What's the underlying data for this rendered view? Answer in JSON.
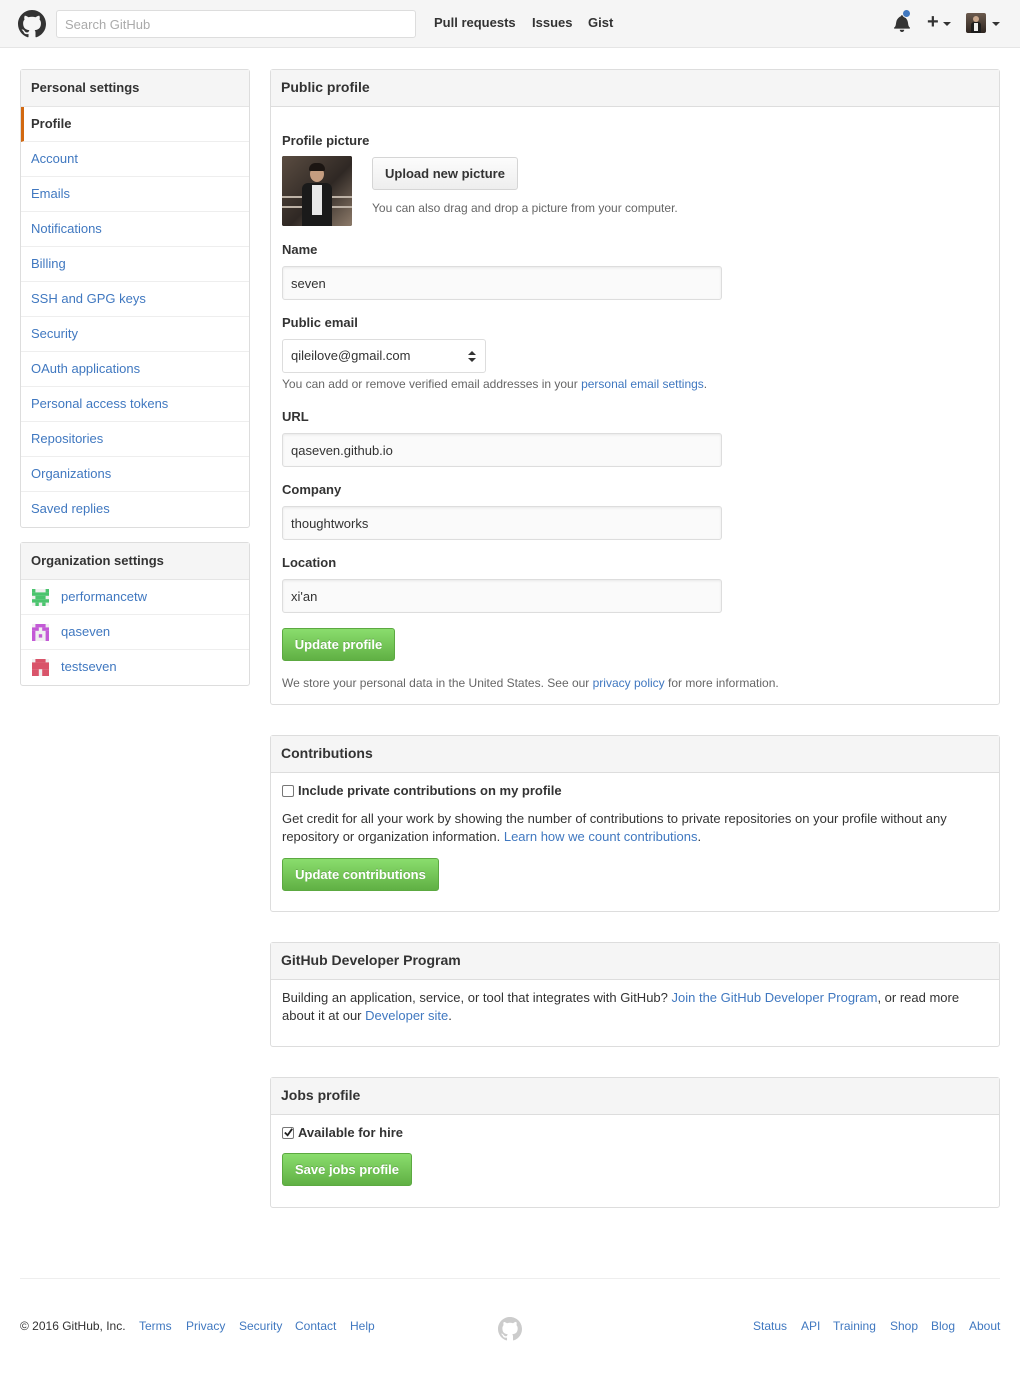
{
  "header": {
    "search_placeholder": "Search GitHub",
    "nav": [
      "Pull requests",
      "Issues",
      "Gist"
    ],
    "notification_indicator": "unread",
    "accent_color": "#4078c0"
  },
  "sidebar": {
    "personal_heading": "Personal settings",
    "items": [
      {
        "label": "Profile",
        "selected": true
      },
      {
        "label": "Account"
      },
      {
        "label": "Emails"
      },
      {
        "label": "Notifications"
      },
      {
        "label": "Billing"
      },
      {
        "label": "SSH and GPG keys"
      },
      {
        "label": "Security"
      },
      {
        "label": "OAuth applications"
      },
      {
        "label": "Personal access tokens"
      },
      {
        "label": "Repositories"
      },
      {
        "label": "Organizations"
      },
      {
        "label": "Saved replies"
      }
    ],
    "org_heading": "Organization settings",
    "orgs": [
      {
        "label": "performancetw",
        "color": "#4bc46e"
      },
      {
        "label": "qaseven",
        "color": "#c35ad6"
      },
      {
        "label": "testseven",
        "color": "#d9546a"
      }
    ]
  },
  "profile": {
    "heading": "Public profile",
    "picture_label": "Profile picture",
    "upload_button": "Upload new picture",
    "upload_note": "You can also drag and drop a picture from your computer.",
    "name_label": "Name",
    "name_value": "seven",
    "email_label": "Public email",
    "email_value": "qileilove@gmail.com",
    "email_note_prefix": "You can add or remove verified email addresses in your ",
    "email_note_link": "personal email settings",
    "email_note_suffix": ".",
    "url_label": "URL",
    "url_value": "qaseven.github.io",
    "company_label": "Company",
    "company_value": "thoughtworks",
    "location_label": "Location",
    "location_value": "xi'an",
    "update_button": "Update profile",
    "privacy_prefix": "We store your personal data in the United States. See our ",
    "privacy_link": "privacy policy",
    "privacy_suffix": " for more information."
  },
  "contributions": {
    "heading": "Contributions",
    "checkbox_label": "Include private contributions on my profile",
    "checked": false,
    "desc_prefix": "Get credit for all your work by showing the number of contributions to private repositories on your profile without any repository or organization information. ",
    "desc_link": "Learn how we count contributions",
    "desc_suffix": ".",
    "button": "Update contributions"
  },
  "developer": {
    "heading": "GitHub Developer Program",
    "desc_prefix": "Building an application, service, or tool that integrates with GitHub? ",
    "desc_link1": "Join the GitHub Developer Program",
    "desc_mid": ", or read more about it at our ",
    "desc_link2": "Developer site",
    "desc_suffix": "."
  },
  "jobs": {
    "heading": "Jobs profile",
    "checkbox_label": "Available for hire",
    "checked": true,
    "button": "Save jobs profile"
  },
  "footer": {
    "copyright": "© 2016 GitHub, Inc.",
    "left_links": [
      "Terms",
      "Privacy",
      "Security",
      "Contact",
      "Help"
    ],
    "right_links": [
      "Status",
      "API",
      "Training",
      "Shop",
      "Blog",
      "About"
    ]
  }
}
